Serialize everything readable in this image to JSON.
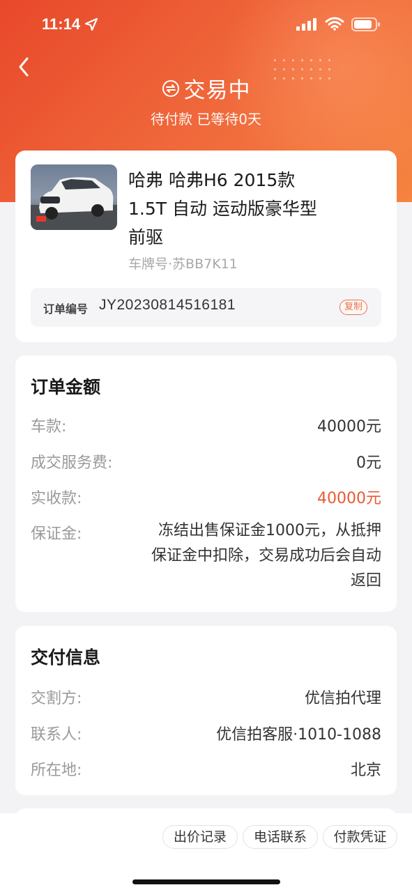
{
  "status_bar": {
    "time": "11:14"
  },
  "header": {
    "title": "交易中",
    "subtitle": "待付款 已等待0天"
  },
  "car": {
    "name": "哈弗 哈弗H6 2015款 1.5T 自动 运动版豪华型前驱",
    "plate": "车牌号·苏BB7K11",
    "order_label": "订单编号",
    "order_no": "JY20230814516181",
    "copy_label": "复制"
  },
  "amount": {
    "title": "订单金额",
    "rows": [
      {
        "label": "车款:",
        "value": "40000元"
      },
      {
        "label": "成交服务费:",
        "value": "0元"
      },
      {
        "label": "实收款:",
        "value": "40000元"
      },
      {
        "label": "保证金:",
        "value": "冻结出售保证金1000元，从抵押保证金中扣除，交易成功后会自动返回"
      }
    ]
  },
  "delivery": {
    "title": "交付信息",
    "rows": [
      {
        "label": "交割方:",
        "value": "优信拍代理"
      },
      {
        "label": "联系人:",
        "value": "优信拍客服·1010-1088"
      },
      {
        "label": "所在地:",
        "value": "北京"
      }
    ]
  },
  "actions": {
    "bid_history": "出价记录",
    "call": "电话联系",
    "payment_proof": "付款凭证"
  },
  "colors": {
    "header_start": "#e8482a",
    "header_end": "#f5843f",
    "accent_red": "#e65a35"
  }
}
